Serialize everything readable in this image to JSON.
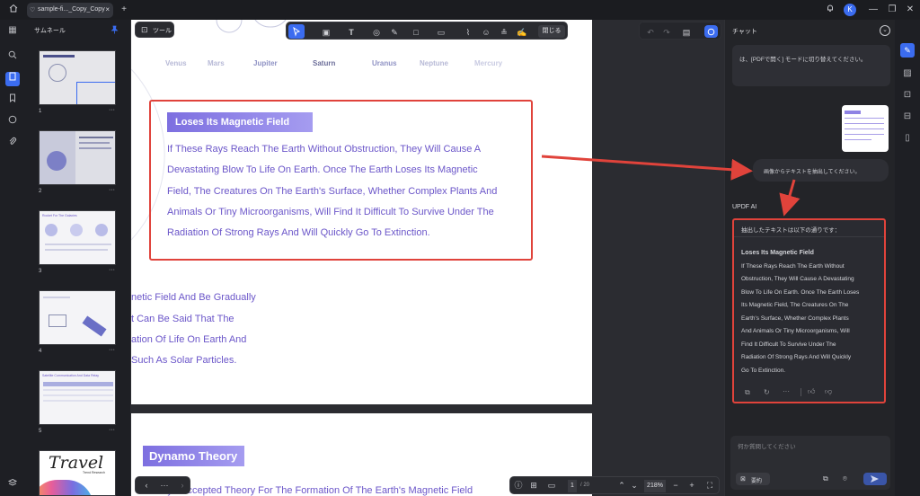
{
  "titlebar": {
    "tab_title": "sample-fi..._Copy_Copy",
    "icons": [
      "home-icon",
      "heart-icon",
      "close-icon",
      "add-tab-icon",
      "bell-icon",
      "avatar",
      "minimize-icon",
      "maximize-icon",
      "window-close-icon"
    ],
    "avatar_letter": "K"
  },
  "thumbnails": {
    "title": "サムネール",
    "pages": [
      "1",
      "2",
      "3",
      "4",
      "5"
    ],
    "more": "···",
    "thumb3_title": "Rocket For The Galaxies",
    "thumb5_title": "Satellite Communication And Data Relay",
    "thumb6_title": "Travel",
    "thumb6_sub": "Trend Research"
  },
  "toolbar": {
    "tools_label": "ツール",
    "close_label": "閉じる"
  },
  "document": {
    "planets": [
      "Venus",
      "Mars",
      "Jupiter",
      "Saturn",
      "Uranus",
      "Neptune",
      "Mercury"
    ],
    "heading": "Loses Its Magnetic Field",
    "paragraph": [
      "If These Rays Reach The Earth Without Obstruction, They Will Cause A",
      "Devastating Blow To Life On Earth. Once The Earth Loses Its Magnetic",
      "Field, The Creatures On The Earth's Surface, Whether Complex Plants And",
      "Animals Or Tiny Microorganisms, Will Find It Difficult To Survive Under The",
      "Radiation Of Strong Rays And Will Quickly Go To Extinction."
    ],
    "fragments": [
      "netic Field And Be Gradually",
      "t Can Be Said That The",
      "ation Of Life On Earth And",
      "Such As Solar Particles."
    ],
    "page2_heading": "Dynamo Theory",
    "page2_line": "Widely - Accepted Theory For The Formation Of The Earth's Magnetic Field"
  },
  "bottombar": {
    "page_current": "1",
    "page_total": "/ 20",
    "zoom": "218%"
  },
  "chat": {
    "title": "チャット",
    "top_bubble": "は、[PDFで開く] モードに切り替えてください。",
    "user_message": "画像からテキストを抽出してください。",
    "ai_label": "UPDF AI",
    "answer_intro": "抽出したテキストは以下の通りです：",
    "answer_heading": "Loses Its Magnetic Field",
    "answer_lines": [
      "If These Rays Reach The Earth Without",
      "Obstruction, They Will Cause A Devastating",
      "Blow To Life On Earth. Once The Earth Loses",
      "Its Magnetic Field, The Creatures On The",
      "Earth's Surface, Whether Complex Plants",
      "And Animals Or Tiny Microorganisms, Will",
      "Find It Difficult To Survive Under The",
      "Radiation Of Strong Rays And Will Quickly",
      "Go To Extinction."
    ],
    "input_placeholder": "何か質問してください",
    "mode_label": "要約"
  },
  "colors": {
    "accent": "#3b6cf0",
    "highlight_red": "#e0433b",
    "doc_text_purple": "#6b56c9"
  }
}
